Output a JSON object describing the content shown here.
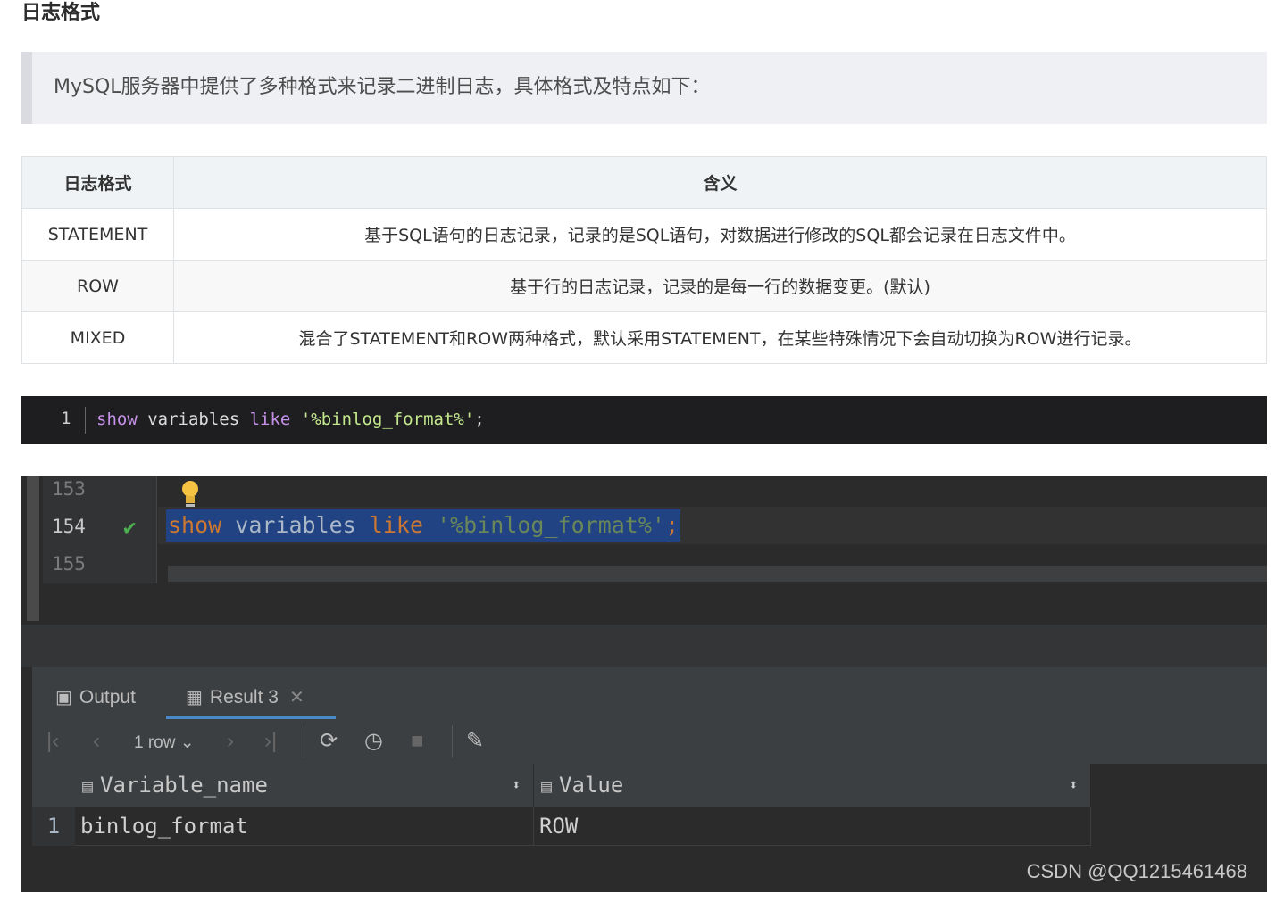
{
  "heading": "日志格式",
  "quote": "MySQL服务器中提供了多种格式来记录二进制日志，具体格式及特点如下：",
  "table": {
    "headers": [
      "日志格式",
      "含义"
    ],
    "rows": [
      [
        "STATEMENT",
        "基于SQL语句的日志记录，记录的是SQL语句，对数据进行修改的SQL都会记录在日志文件中。"
      ],
      [
        "ROW",
        "基于行的日志记录，记录的是每一行的数据变更。(默认)"
      ],
      [
        "MIXED",
        "混合了STATEMENT和ROW两种格式，默认采用STATEMENT，在某些特殊情况下会自动切换为ROW进行记录。"
      ]
    ]
  },
  "code": {
    "line_number": "1",
    "kw_show": "show",
    "plain_variables": " variables ",
    "kw_like": "like",
    "space": " ",
    "string": "'%binlog_format%'",
    "semicolon": ";"
  },
  "ide": {
    "lines": [
      "153",
      "154",
      "155"
    ],
    "check": "✔",
    "query_show": "show",
    "query_variables": " variables ",
    "query_like": "like",
    "query_space": " ",
    "query_string": "'%binlog_format%'",
    "query_semicolon": ";",
    "tabs": {
      "output": "Output",
      "result": "Result 3",
      "close": "✕"
    },
    "toolbar": {
      "rows": "1 row"
    },
    "grid": {
      "columns": [
        "Variable_name",
        "Value"
      ],
      "rows": [
        {
          "num": "1",
          "variable_name": "binlog_format",
          "value": "ROW"
        }
      ]
    }
  },
  "watermark": "CSDN @QQ1215461468",
  "colors": {
    "ide_bg": "#2b2b2b",
    "selection": "#214283",
    "keyword": "#cc7832",
    "string": "#6a8759",
    "check": "#4caf50",
    "tab_underline": "#4a88c7"
  }
}
